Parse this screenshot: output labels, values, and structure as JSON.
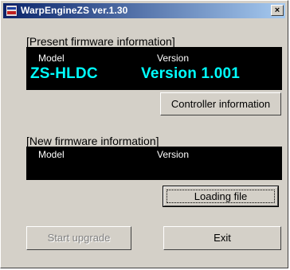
{
  "window": {
    "title": "WarpEngineZS ver.1.30",
    "close_glyph": "×",
    "app_icon": "application-icon"
  },
  "present": {
    "section_label": "[Present firmware information]",
    "model_header": "Model",
    "version_header": "Version",
    "model_value": "ZS-HLDC",
    "version_value": "Version 1.001",
    "controller_button": "Controller information"
  },
  "new": {
    "section_label": "[New firmware information]",
    "model_header": "Model",
    "version_header": "Version",
    "loading_button": "Loading file"
  },
  "actions": {
    "start_upgrade": "Start upgrade",
    "exit": "Exit"
  },
  "colors": {
    "title_start": "#0a246a",
    "title_end": "#a6caf0",
    "value_text": "#00ffff",
    "panel_bg": "#000000",
    "face": "#d4d0c8"
  }
}
